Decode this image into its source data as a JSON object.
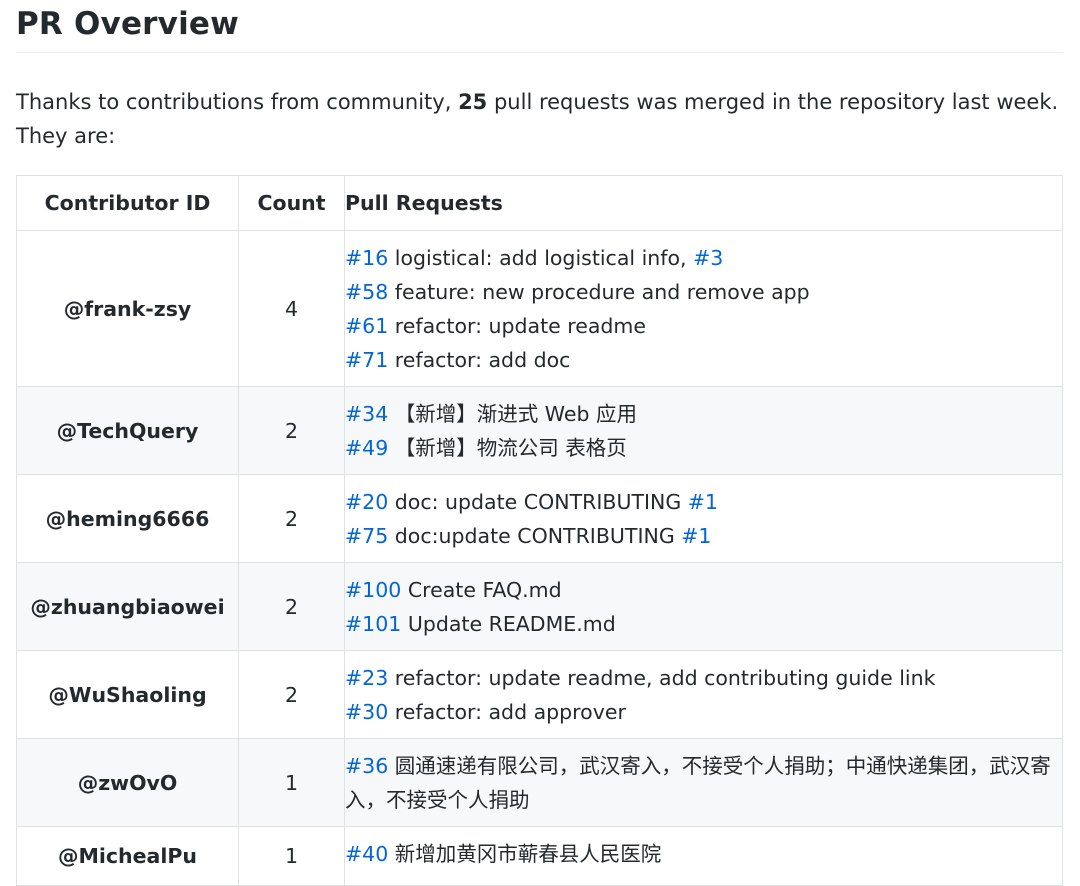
{
  "page": {
    "title": "PR Overview",
    "intro_prefix": "Thanks to contributions from community, ",
    "intro_count": "25",
    "intro_suffix": " pull requests was merged in the repository last week. They are:"
  },
  "table": {
    "headers": [
      "Contributor ID",
      "Count",
      "Pull Requests"
    ],
    "rows": [
      {
        "contributor": "@frank-zsy",
        "count": "4",
        "prs": [
          [
            {
              "link": "#16"
            },
            {
              "text": " logistical: add logistical info, "
            },
            {
              "link": "#3"
            }
          ],
          [
            {
              "link": "#58"
            },
            {
              "text": " feature: new procedure and remove app"
            }
          ],
          [
            {
              "link": "#61"
            },
            {
              "text": " refactor: update readme"
            }
          ],
          [
            {
              "link": "#71"
            },
            {
              "text": " refactor: add doc"
            }
          ]
        ]
      },
      {
        "contributor": "@TechQuery",
        "count": "2",
        "prs": [
          [
            {
              "link": "#34"
            },
            {
              "text": " 【新增】渐进式 Web 应用"
            }
          ],
          [
            {
              "link": "#49"
            },
            {
              "text": " 【新增】物流公司 表格页"
            }
          ]
        ]
      },
      {
        "contributor": "@heming6666",
        "count": "2",
        "prs": [
          [
            {
              "link": "#20"
            },
            {
              "text": " doc: update CONTRIBUTING "
            },
            {
              "link": "#1"
            }
          ],
          [
            {
              "link": "#75"
            },
            {
              "text": " doc:update CONTRIBUTING "
            },
            {
              "link": "#1"
            }
          ]
        ]
      },
      {
        "contributor": "@zhuangbiaowei",
        "count": "2",
        "prs": [
          [
            {
              "link": "#100"
            },
            {
              "text": " Create FAQ.md"
            }
          ],
          [
            {
              "link": "#101"
            },
            {
              "text": " Update README.md"
            }
          ]
        ]
      },
      {
        "contributor": "@WuShaoling",
        "count": "2",
        "prs": [
          [
            {
              "link": "#23"
            },
            {
              "text": " refactor: update readme, add contributing guide link"
            }
          ],
          [
            {
              "link": "#30"
            },
            {
              "text": " refactor: add approver"
            }
          ]
        ]
      },
      {
        "contributor": "@zwOvO",
        "count": "1",
        "prs": [
          [
            {
              "link": "#36"
            },
            {
              "text": " 圆通速递有限公司，武汉寄入，不接受个人捐助；中通快递集团，武汉寄入，不接受个人捐助"
            }
          ]
        ]
      },
      {
        "contributor": "@MichealPu",
        "count": "1",
        "prs": [
          [
            {
              "link": "#40"
            },
            {
              "text": " 新增加黄冈市蕲春县人民医院"
            }
          ]
        ]
      }
    ]
  },
  "colors": {
    "link": "#0366d6",
    "text": "#24292e",
    "border": "#dfe2e5",
    "row_alt": "#f6f8fa"
  }
}
